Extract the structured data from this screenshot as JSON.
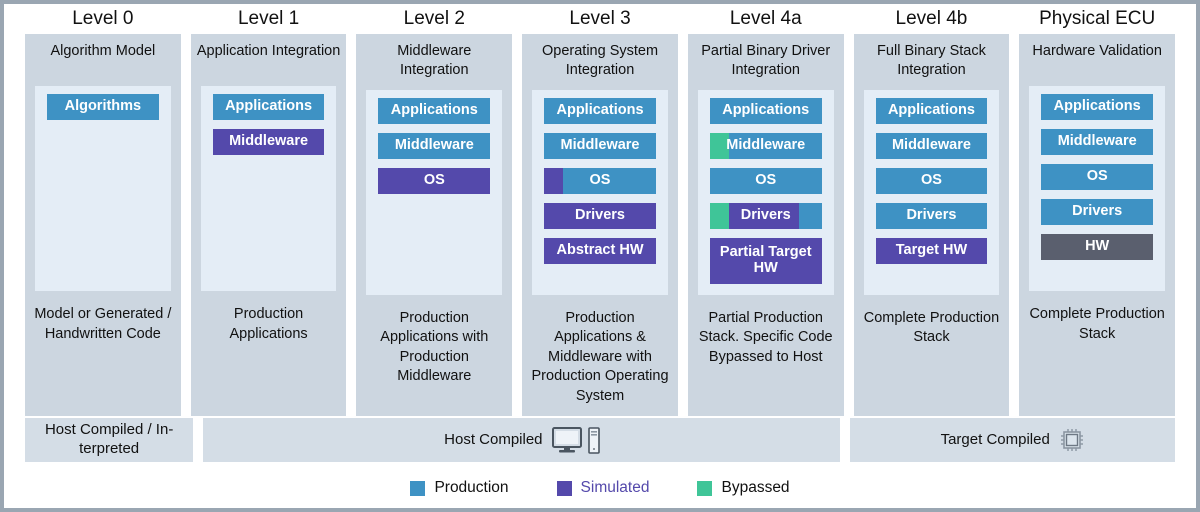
{
  "colors": {
    "production": "#3e92c4",
    "simulated": "#5449ab",
    "bypassed": "#3fc598",
    "hardware": "#5a5f6e",
    "column_bg": "#ccd6e0",
    "stack_bg": "#e4edf6",
    "band_bg": "#d4dde6",
    "frame_border": "#9aa6b2",
    "text": "#111111"
  },
  "columns": [
    {
      "level": "Level 0",
      "title": "Algorithm Model",
      "footer": "Model or Generated / Handwritten Code",
      "layers": [
        {
          "label": "Algorithms",
          "segments": [
            {
              "color": "production",
              "pct": 100
            }
          ]
        }
      ]
    },
    {
      "level": "Level 1",
      "title": "Application Integration",
      "footer": "Production Applications",
      "layers": [
        {
          "label": "Applications",
          "segments": [
            {
              "color": "production",
              "pct": 100
            }
          ]
        },
        {
          "label": "Middleware",
          "segments": [
            {
              "color": "simulated",
              "pct": 100
            }
          ]
        }
      ]
    },
    {
      "level": "Level 2",
      "title": "Middleware Integration",
      "footer": "Production Applications with Production Middleware",
      "layers": [
        {
          "label": "Applications",
          "segments": [
            {
              "color": "production",
              "pct": 100
            }
          ]
        },
        {
          "label": "Middleware",
          "segments": [
            {
              "color": "production",
              "pct": 100
            }
          ]
        },
        {
          "label": "OS",
          "segments": [
            {
              "color": "simulated",
              "pct": 100
            }
          ]
        }
      ]
    },
    {
      "level": "Level 3",
      "title": "Operating System Integration",
      "footer": "Production Applications & Middleware with Production Operating System",
      "layers": [
        {
          "label": "Applications",
          "segments": [
            {
              "color": "production",
              "pct": 100
            }
          ]
        },
        {
          "label": "Middleware",
          "segments": [
            {
              "color": "production",
              "pct": 100
            }
          ]
        },
        {
          "label": "OS",
          "segments": [
            {
              "color": "simulated",
              "pct": 17
            },
            {
              "color": "production",
              "pct": 83
            }
          ]
        },
        {
          "label": "Drivers",
          "segments": [
            {
              "color": "simulated",
              "pct": 100
            }
          ]
        },
        {
          "label": "Abstract HW",
          "segments": [
            {
              "color": "simulated",
              "pct": 100
            }
          ]
        }
      ]
    },
    {
      "level": "Level 4a",
      "title": "Partial Binary Driver Integration",
      "footer": "Partial Production Stack. Specific Code Bypassed to Host",
      "layers": [
        {
          "label": "Applications",
          "segments": [
            {
              "color": "production",
              "pct": 100
            }
          ]
        },
        {
          "label": "Middleware",
          "segments": [
            {
              "color": "bypassed",
              "pct": 17
            },
            {
              "color": "production",
              "pct": 83
            }
          ]
        },
        {
          "label": "OS",
          "segments": [
            {
              "color": "production",
              "pct": 100
            }
          ]
        },
        {
          "label": "Drivers",
          "segments": [
            {
              "color": "bypassed",
              "pct": 17
            },
            {
              "color": "simulated",
              "pct": 63
            },
            {
              "color": "production",
              "pct": 20
            }
          ]
        },
        {
          "label": "Partial Target HW",
          "tall": true,
          "segments": [
            {
              "color": "simulated",
              "pct": 100
            }
          ]
        }
      ]
    },
    {
      "level": "Level 4b",
      "title": "Full Binary Stack Integration",
      "footer": "Complete Production Stack",
      "layers": [
        {
          "label": "Applications",
          "segments": [
            {
              "color": "production",
              "pct": 100
            }
          ]
        },
        {
          "label": "Middleware",
          "segments": [
            {
              "color": "production",
              "pct": 100
            }
          ]
        },
        {
          "label": "OS",
          "segments": [
            {
              "color": "production",
              "pct": 100
            }
          ]
        },
        {
          "label": "Drivers",
          "segments": [
            {
              "color": "production",
              "pct": 100
            }
          ]
        },
        {
          "label": "Target HW",
          "segments": [
            {
              "color": "simulated",
              "pct": 100
            }
          ]
        }
      ]
    },
    {
      "level": "Physical ECU",
      "title": "Hardware Validation",
      "footer": "Complete Production Stack",
      "layers": [
        {
          "label": "Applications",
          "segments": [
            {
              "color": "production",
              "pct": 100
            }
          ]
        },
        {
          "label": "Middleware",
          "segments": [
            {
              "color": "production",
              "pct": 100
            }
          ]
        },
        {
          "label": "OS",
          "segments": [
            {
              "color": "production",
              "pct": 100
            }
          ]
        },
        {
          "label": "Drivers",
          "segments": [
            {
              "color": "production",
              "pct": 100
            }
          ]
        },
        {
          "label": "HW",
          "segments": [
            {
              "color": "hardware",
              "pct": 100
            }
          ]
        }
      ]
    }
  ],
  "bands": [
    {
      "label": "Host Compiled / In-terpreted",
      "icons": []
    },
    {
      "label": "Host Compiled",
      "icons": [
        "monitor-icon",
        "tower-icon"
      ]
    },
    {
      "label": "Target Compiled",
      "icons": [
        "chip-icon"
      ]
    }
  ],
  "legend": [
    {
      "label": "Production",
      "color": "#3e92c4",
      "text_color": "#111111"
    },
    {
      "label": "Simulated",
      "color": "#5449ab",
      "text_color": "#5449ab"
    },
    {
      "label": "Bypassed",
      "color": "#3fc598",
      "text_color": "#111111"
    }
  ]
}
